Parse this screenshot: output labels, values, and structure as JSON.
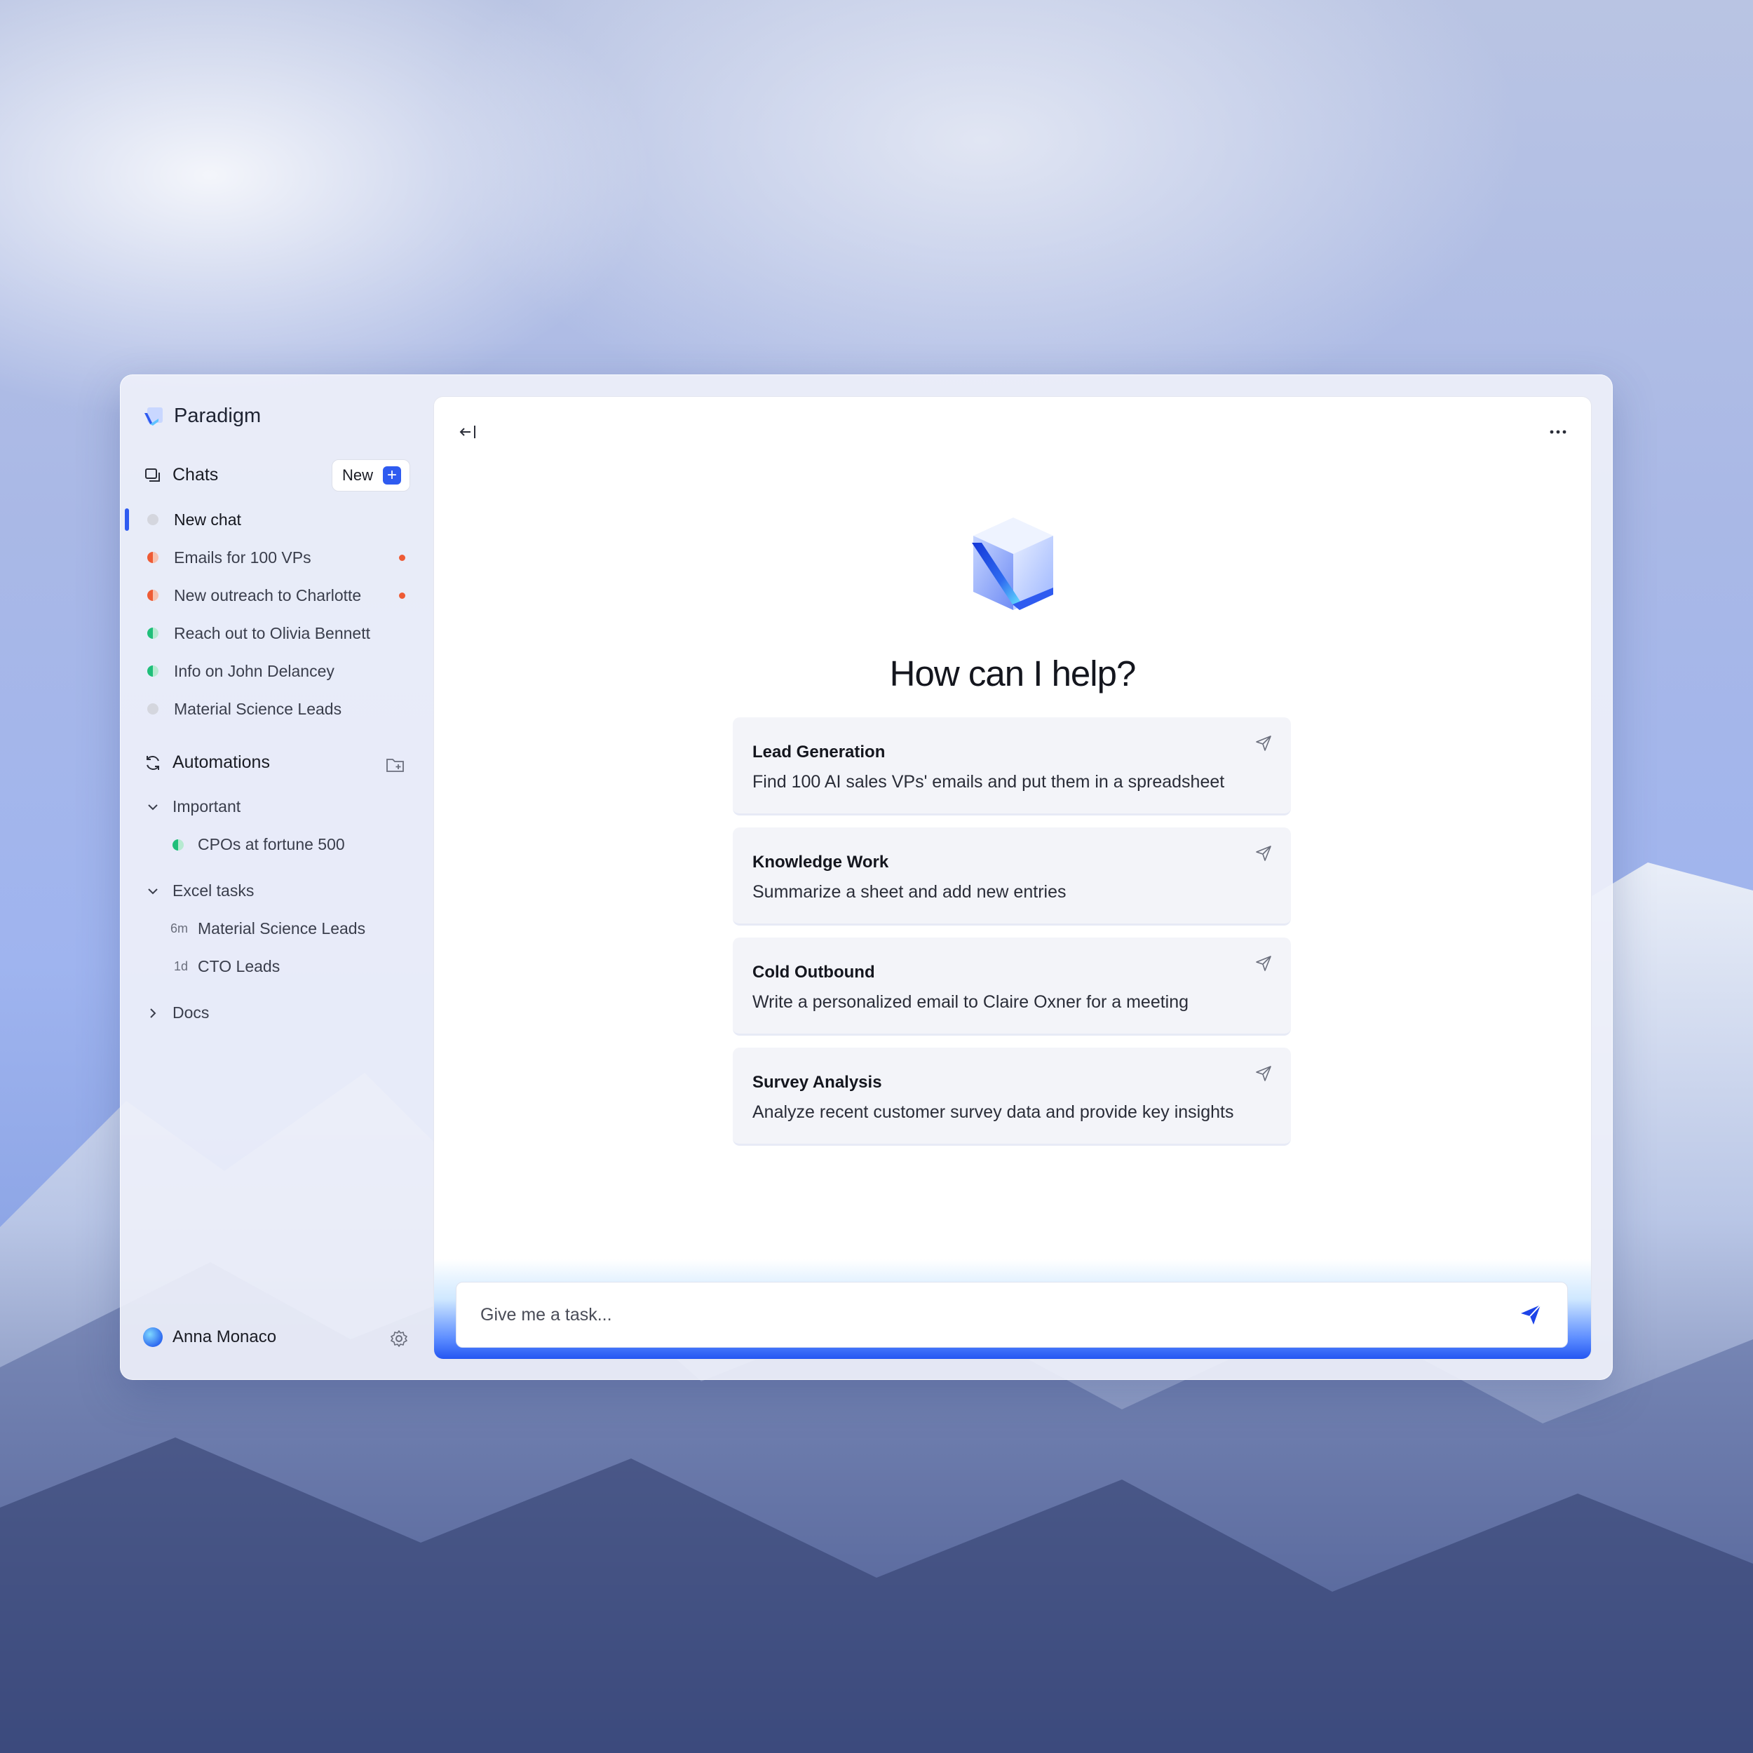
{
  "app": {
    "name": "Paradigm"
  },
  "chats": {
    "title": "Chats",
    "new_label": "New",
    "items": [
      {
        "label": "New chat",
        "status_color": "#d4d6de",
        "unread": false,
        "active": true
      },
      {
        "label": "Emails for 100 VPs",
        "status_color": "#ee5b35",
        "unread": true,
        "active": false
      },
      {
        "label": "New outreach to Charlotte",
        "status_color": "#ee5b35",
        "unread": true,
        "active": false
      },
      {
        "label": "Reach out to Olivia Bennett",
        "status_color": "#1fbf7a",
        "unread": false,
        "active": false
      },
      {
        "label": "Info on John Delancey",
        "status_color": "#1fbf7a",
        "unread": false,
        "active": false
      },
      {
        "label": "Material Science Leads",
        "status_color": "#d4d6de",
        "unread": false,
        "active": false
      }
    ]
  },
  "automations": {
    "title": "Automations",
    "groups": [
      {
        "label": "Important",
        "expanded": true,
        "items": [
          {
            "label": "CPOs at fortune 500",
            "status_color": "#1fbf7a"
          }
        ]
      },
      {
        "label": "Excel tasks",
        "expanded": true,
        "items": [
          {
            "time": "6m",
            "label": "Material Science Leads"
          },
          {
            "time": "1d",
            "label": "CTO Leads"
          }
        ]
      },
      {
        "label": "Docs",
        "expanded": false,
        "items": []
      }
    ]
  },
  "user": {
    "name": "Anna Monaco"
  },
  "main": {
    "heading": "How can I help?",
    "suggestions": [
      {
        "title": "Lead Generation",
        "description": "Find 100 AI sales VPs' emails and put them in a spreadsheet"
      },
      {
        "title": "Knowledge Work",
        "description": "Summarize a sheet and add new entries"
      },
      {
        "title": "Cold Outbound",
        "description": "Write a personalized email to Claire Oxner for a meeting"
      },
      {
        "title": "Survey Analysis",
        "description": "Analyze recent customer survey data and provide key insights"
      }
    ],
    "input_placeholder": "Give me a task..."
  },
  "colors": {
    "accent": "#2f5bf0",
    "unread": "#ee5b35",
    "online": "#1fbf7a"
  }
}
